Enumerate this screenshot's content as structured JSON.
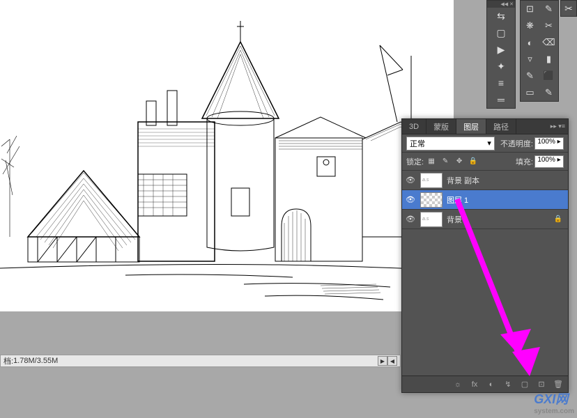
{
  "status": {
    "doc_label": "档:",
    "filesize": "1.78M/3.55M"
  },
  "tools_left": [
    "⇆",
    "▢",
    "▶",
    "✦",
    "≡",
    "═"
  ],
  "tools_right": [
    [
      "⊡",
      "✎"
    ],
    [
      "❋",
      "✂"
    ],
    [
      "◐",
      "⌫"
    ],
    [
      "▿",
      "▮"
    ],
    [
      "✎",
      "⬛"
    ],
    [
      "▭",
      "✎"
    ]
  ],
  "layers_panel": {
    "tabs": [
      "3D",
      "蒙版",
      "图层",
      "路径"
    ],
    "active_tab": 2,
    "blend_mode": "正常",
    "opacity_label": "不透明度:",
    "opacity_value": "100% ▸",
    "lock_label": "锁定:",
    "fill_label": "填充:",
    "fill_value": "100% ▸",
    "layers": [
      {
        "name": "背景 副本",
        "selected": false,
        "transparent": false,
        "locked": false
      },
      {
        "name": "图层 1",
        "selected": true,
        "transparent": true,
        "locked": false
      },
      {
        "name": "背景",
        "selected": false,
        "transparent": false,
        "locked": true
      }
    ],
    "footer_icons": [
      "☼",
      "fx",
      "◐",
      "↯",
      "▢",
      "⊡",
      "🗑"
    ]
  },
  "watermark": {
    "main": "GXI网",
    "sub": "system.com"
  }
}
